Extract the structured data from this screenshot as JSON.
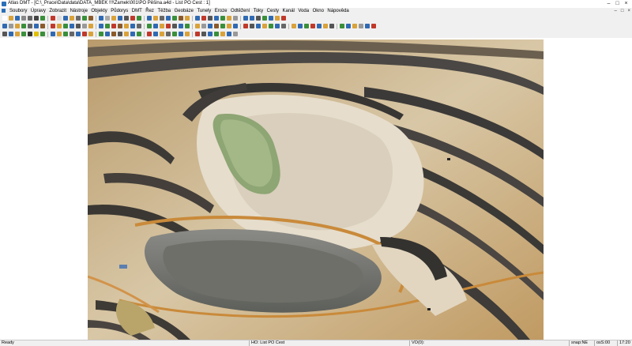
{
  "window": {
    "title": "Atlas DMT - [C:\\_Prace\\Data\\data\\DATA_MBEK !!!\\Zamek\\001\\PO Pěšina.a4d - List PO Cest : 1]",
    "minimize": "–",
    "maximize": "□",
    "close": "×"
  },
  "menu": {
    "items": [
      "Soubory",
      "Úpravy",
      "Zobrazit",
      "Nástroje",
      "Objekty",
      "Půdorys",
      "DMT",
      "Řez",
      "Těžba",
      "Geobáze",
      "Tunely",
      "Eroze",
      "Odtěžení",
      "Toky",
      "Cesty",
      "Kanál",
      "Voda",
      "Okno",
      "Nápověda"
    ],
    "right_controls": [
      "–",
      "□",
      "×"
    ]
  },
  "toolbars": {
    "row1_colors": [
      "#ffffff",
      "#d9a23a",
      "#2f6ab3",
      "#888888",
      "#666666",
      "#444444",
      "#3a8f3a",
      "#c0392b",
      "#dddddd",
      "#2f6ab3",
      "#d9a23a",
      "#6b6b6b",
      "#3a8f3a",
      "#8b5a2b",
      "#2f6ab3",
      "#aaaaaa",
      "#d9a23a",
      "#2f6ab3",
      "#555555",
      "#c0392b",
      "#3a8f3a",
      "#2f6ab3",
      "#d9a23a",
      "#666666",
      "#2f6ab3",
      "#3a8f3a",
      "#8b5a2b",
      "#d9a23a",
      "#2f6ab3",
      "#c0392b",
      "#555555",
      "#2f6ab3",
      "#3a8f3a",
      "#d9a23a",
      "#999999",
      "#2f6ab3",
      "#2f6ab3",
      "#555555",
      "#3a8f3a",
      "#2f6ab3",
      "#d9a23a",
      "#c0392b"
    ],
    "row2_colors": [
      "#2f6ab3",
      "#999999",
      "#d9a23a",
      "#3a8f3a",
      "#666666",
      "#2f6ab3",
      "#8b5a2b",
      "#c0392b",
      "#d9a23a",
      "#3a8f3a",
      "#2f6ab3",
      "#555555",
      "#999999",
      "#d9a23a",
      "#2f6ab3",
      "#3a8f3a",
      "#c0392b",
      "#8b5a2b",
      "#d9a23a",
      "#2f6ab3",
      "#666666",
      "#3a8f3a",
      "#2f6ab3",
      "#d9a23a",
      "#c0392b",
      "#555555",
      "#2f6ab3",
      "#3a8f3a",
      "#d9a23a",
      "#999999",
      "#2f6ab3",
      "#8b5a2b",
      "#3a8f3a",
      "#d9a23a",
      "#2f6ab3",
      "#c0392b",
      "#555555",
      "#2f6ab3",
      "#d9a23a",
      "#3a8f3a",
      "#2f6ab3",
      "#666666",
      "#d9a23a",
      "#2f6ab3",
      "#3a8f3a",
      "#c0392b",
      "#2f6ab3",
      "#d9a23a",
      "#555555",
      "#3a8f3a",
      "#2f6ab3",
      "#d9a23a",
      "#999999",
      "#2f6ab3",
      "#c0392b"
    ],
    "row3_colors": [
      "#555555",
      "#2f6ab3",
      "#d9a23a",
      "#3a8f3a",
      "#333333",
      "#e0c000",
      "#3a8f3a",
      "#2f6ab3",
      "#d9a23a",
      "#3a8f3a",
      "#666666",
      "#2f6ab3",
      "#c0392b",
      "#d9a23a",
      "#3a8f3a",
      "#2f6ab3",
      "#8b5a2b",
      "#555555",
      "#d9a23a",
      "#2f6ab3",
      "#3a8f3a",
      "#c0392b",
      "#2f6ab3",
      "#d9a23a",
      "#666666",
      "#3a8f3a",
      "#2f6ab3",
      "#d9a23a",
      "#c0392b",
      "#555555",
      "#2f6ab3",
      "#3a8f3a",
      "#d9a23a",
      "#2f6ab3",
      "#999999"
    ],
    "row4_colors": [
      "#2f6ab3",
      "#d9a23a",
      "#555555",
      "#3a8f3a",
      "#2f6ab3",
      "#c0392b",
      "#d9a23a",
      "#666666",
      "#2f6ab3",
      "#3a8f3a",
      "#d9a23a",
      "#555555",
      "#2f6ab3",
      "#c0392b",
      "#3a8f3a",
      "#d9a23a",
      "#2f6ab3",
      "#8b5a2b",
      "#999999",
      "#2f6ab3",
      "#3a8f3a",
      "#d9a23a",
      "#c0392b",
      "#2f6ab3",
      "#555555",
      "#d9a23a",
      "#3a8f3a",
      "#2f6ab3",
      "#d9a23a",
      "#c0392b",
      "#2f6ab3",
      "#666666",
      "#3a8f3a",
      "#d9a23a",
      "#2f6ab3",
      "#555555",
      "#c0392b"
    ]
  },
  "canvas": {
    "image": "aerial-quarry-photo"
  },
  "status": {
    "ready": "Ready",
    "layer": "HO: List PO Cest",
    "vo": "VO(0):",
    "snap": "snap:NE",
    "scale": "osS:00",
    "time": "17:20"
  }
}
